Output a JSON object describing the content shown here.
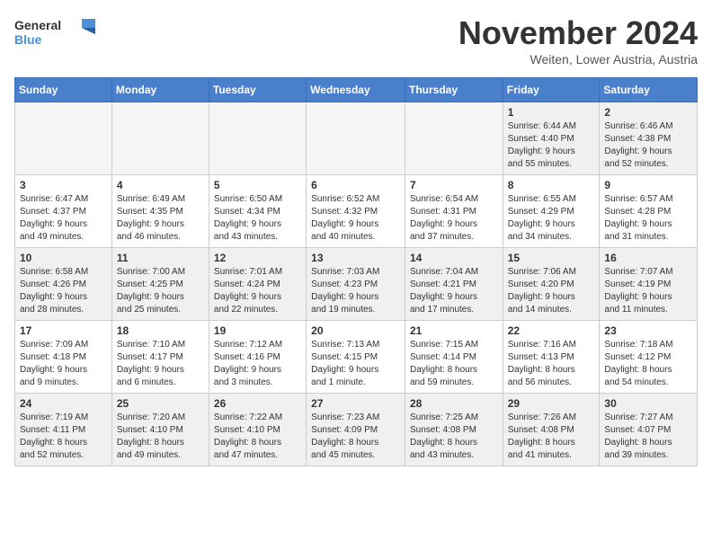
{
  "logo": {
    "line1": "General",
    "line2": "Blue"
  },
  "title": "November 2024",
  "subtitle": "Weiten, Lower Austria, Austria",
  "headers": [
    "Sunday",
    "Monday",
    "Tuesday",
    "Wednesday",
    "Thursday",
    "Friday",
    "Saturday"
  ],
  "weeks": [
    [
      {
        "day": "",
        "info": ""
      },
      {
        "day": "",
        "info": ""
      },
      {
        "day": "",
        "info": ""
      },
      {
        "day": "",
        "info": ""
      },
      {
        "day": "",
        "info": ""
      },
      {
        "day": "1",
        "info": "Sunrise: 6:44 AM\nSunset: 4:40 PM\nDaylight: 9 hours\nand 55 minutes."
      },
      {
        "day": "2",
        "info": "Sunrise: 6:46 AM\nSunset: 4:38 PM\nDaylight: 9 hours\nand 52 minutes."
      }
    ],
    [
      {
        "day": "3",
        "info": "Sunrise: 6:47 AM\nSunset: 4:37 PM\nDaylight: 9 hours\nand 49 minutes."
      },
      {
        "day": "4",
        "info": "Sunrise: 6:49 AM\nSunset: 4:35 PM\nDaylight: 9 hours\nand 46 minutes."
      },
      {
        "day": "5",
        "info": "Sunrise: 6:50 AM\nSunset: 4:34 PM\nDaylight: 9 hours\nand 43 minutes."
      },
      {
        "day": "6",
        "info": "Sunrise: 6:52 AM\nSunset: 4:32 PM\nDaylight: 9 hours\nand 40 minutes."
      },
      {
        "day": "7",
        "info": "Sunrise: 6:54 AM\nSunset: 4:31 PM\nDaylight: 9 hours\nand 37 minutes."
      },
      {
        "day": "8",
        "info": "Sunrise: 6:55 AM\nSunset: 4:29 PM\nDaylight: 9 hours\nand 34 minutes."
      },
      {
        "day": "9",
        "info": "Sunrise: 6:57 AM\nSunset: 4:28 PM\nDaylight: 9 hours\nand 31 minutes."
      }
    ],
    [
      {
        "day": "10",
        "info": "Sunrise: 6:58 AM\nSunset: 4:26 PM\nDaylight: 9 hours\nand 28 minutes."
      },
      {
        "day": "11",
        "info": "Sunrise: 7:00 AM\nSunset: 4:25 PM\nDaylight: 9 hours\nand 25 minutes."
      },
      {
        "day": "12",
        "info": "Sunrise: 7:01 AM\nSunset: 4:24 PM\nDaylight: 9 hours\nand 22 minutes."
      },
      {
        "day": "13",
        "info": "Sunrise: 7:03 AM\nSunset: 4:23 PM\nDaylight: 9 hours\nand 19 minutes."
      },
      {
        "day": "14",
        "info": "Sunrise: 7:04 AM\nSunset: 4:21 PM\nDaylight: 9 hours\nand 17 minutes."
      },
      {
        "day": "15",
        "info": "Sunrise: 7:06 AM\nSunset: 4:20 PM\nDaylight: 9 hours\nand 14 minutes."
      },
      {
        "day": "16",
        "info": "Sunrise: 7:07 AM\nSunset: 4:19 PM\nDaylight: 9 hours\nand 11 minutes."
      }
    ],
    [
      {
        "day": "17",
        "info": "Sunrise: 7:09 AM\nSunset: 4:18 PM\nDaylight: 9 hours\nand 9 minutes."
      },
      {
        "day": "18",
        "info": "Sunrise: 7:10 AM\nSunset: 4:17 PM\nDaylight: 9 hours\nand 6 minutes."
      },
      {
        "day": "19",
        "info": "Sunrise: 7:12 AM\nSunset: 4:16 PM\nDaylight: 9 hours\nand 3 minutes."
      },
      {
        "day": "20",
        "info": "Sunrise: 7:13 AM\nSunset: 4:15 PM\nDaylight: 9 hours\nand 1 minute."
      },
      {
        "day": "21",
        "info": "Sunrise: 7:15 AM\nSunset: 4:14 PM\nDaylight: 8 hours\nand 59 minutes."
      },
      {
        "day": "22",
        "info": "Sunrise: 7:16 AM\nSunset: 4:13 PM\nDaylight: 8 hours\nand 56 minutes."
      },
      {
        "day": "23",
        "info": "Sunrise: 7:18 AM\nSunset: 4:12 PM\nDaylight: 8 hours\nand 54 minutes."
      }
    ],
    [
      {
        "day": "24",
        "info": "Sunrise: 7:19 AM\nSunset: 4:11 PM\nDaylight: 8 hours\nand 52 minutes."
      },
      {
        "day": "25",
        "info": "Sunrise: 7:20 AM\nSunset: 4:10 PM\nDaylight: 8 hours\nand 49 minutes."
      },
      {
        "day": "26",
        "info": "Sunrise: 7:22 AM\nSunset: 4:10 PM\nDaylight: 8 hours\nand 47 minutes."
      },
      {
        "day": "27",
        "info": "Sunrise: 7:23 AM\nSunset: 4:09 PM\nDaylight: 8 hours\nand 45 minutes."
      },
      {
        "day": "28",
        "info": "Sunrise: 7:25 AM\nSunset: 4:08 PM\nDaylight: 8 hours\nand 43 minutes."
      },
      {
        "day": "29",
        "info": "Sunrise: 7:26 AM\nSunset: 4:08 PM\nDaylight: 8 hours\nand 41 minutes."
      },
      {
        "day": "30",
        "info": "Sunrise: 7:27 AM\nSunset: 4:07 PM\nDaylight: 8 hours\nand 39 minutes."
      }
    ]
  ]
}
